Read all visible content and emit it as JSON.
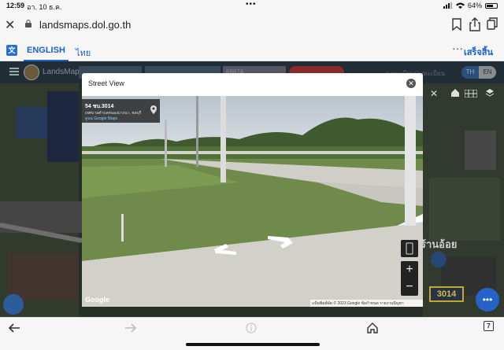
{
  "status": {
    "time": "12:59",
    "date": "อา. 10 ธ.ค.",
    "battery": "64%",
    "battery_level": 0.64,
    "dots": "•••"
  },
  "browser": {
    "url": "landsmaps.dol.go.th"
  },
  "translate": {
    "tab_english": "ENGLISH",
    "tab_thai": "ไทย",
    "more": "···",
    "done": "เสร็จสิ้น"
  },
  "app": {
    "name": "LandsMaps",
    "parcel_value": "68874",
    "register_link": "ลงทะเบียน/ลงทะเบียน",
    "lang_th": "TH",
    "lang_en": "EN"
  },
  "map": {
    "place_label": "ร้านอ้อย",
    "road_label": "3014"
  },
  "streetview": {
    "title": "Street View",
    "address": "54 ชบ.3014",
    "sub_address": "เทศบาลตำบลหนองบางนา, ชลบุรี",
    "maps_link": "ดูบน Google Maps",
    "google_logo": "Google",
    "attribution": "แป้นพิมพ์ลัด  © 2023 Google  ข้อกำหนด  รายงานปัญหา"
  },
  "toolbar": {
    "tab_count": "7"
  }
}
